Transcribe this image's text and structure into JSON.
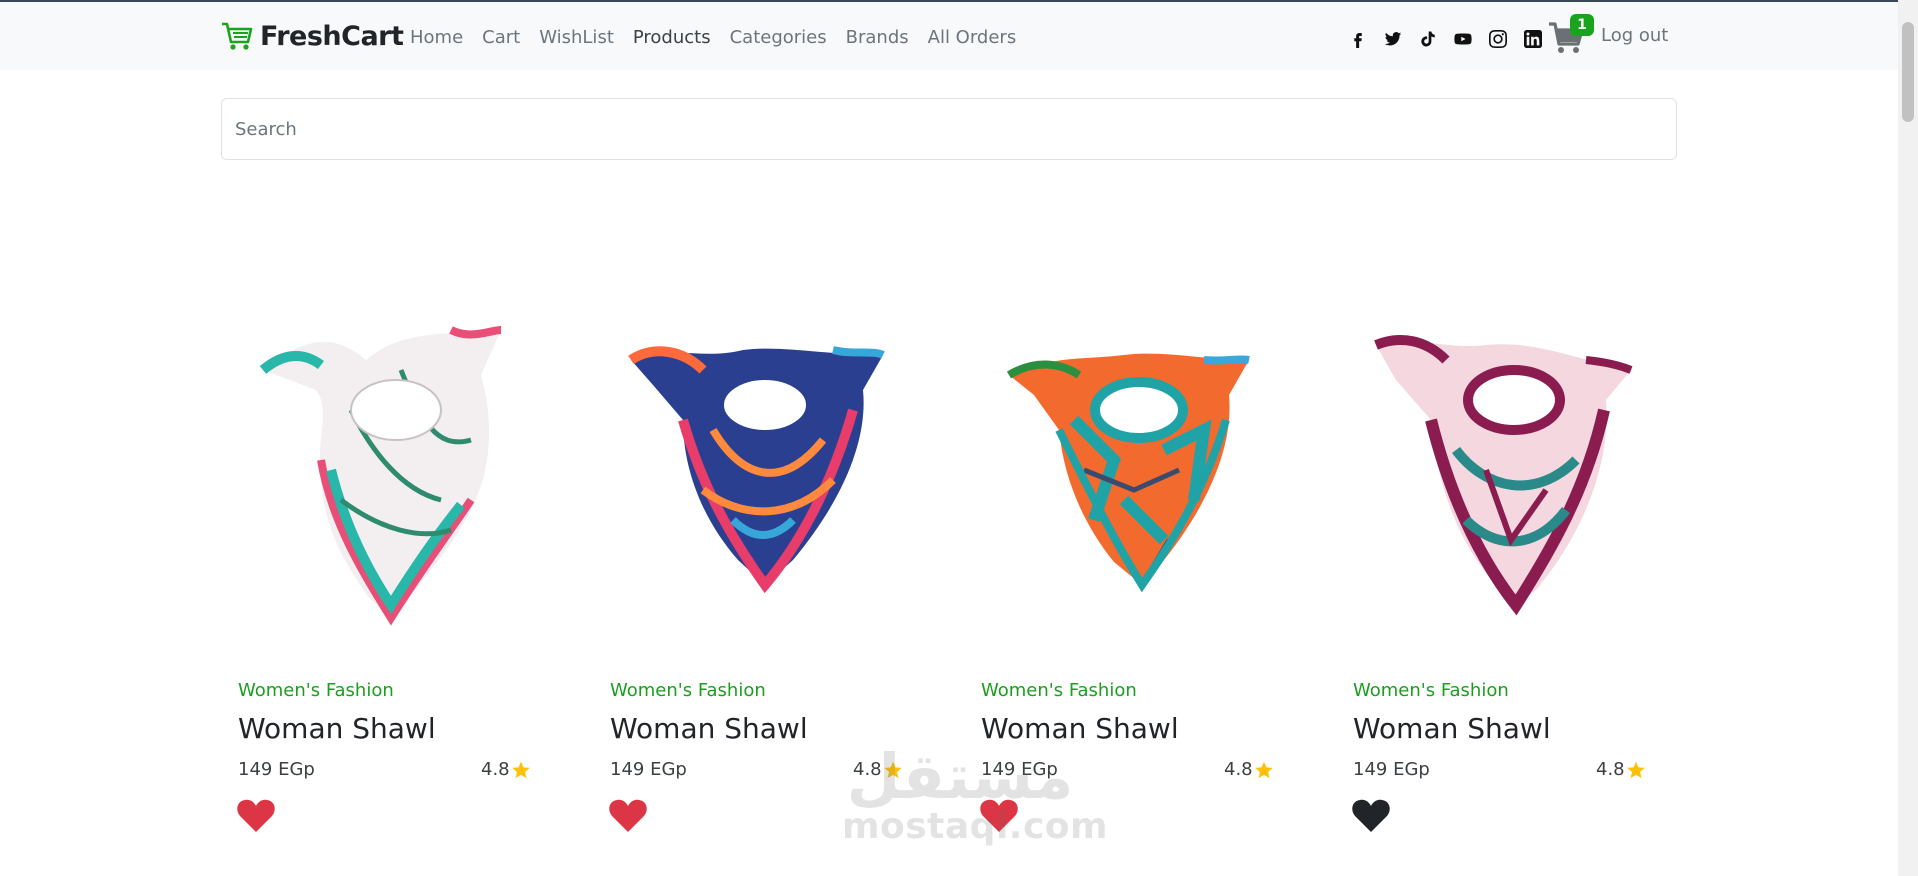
{
  "nav": {
    "brand": "FreshCart",
    "links": [
      "Home",
      "Cart",
      "WishList",
      "Products",
      "Categories",
      "Brands",
      "All Orders"
    ],
    "socials": [
      "facebook-icon",
      "twitter-icon",
      "tiktok-icon",
      "youtube-icon",
      "instagram-icon",
      "linkedin-icon"
    ],
    "cart_count": "1",
    "logout": "Log out"
  },
  "search": {
    "placeholder": "Search",
    "value": ""
  },
  "products": [
    {
      "category": "Women's Fashion",
      "title": "Woman Shawl",
      "price": "149 EGp",
      "rating": "4.8",
      "wishlisted": true
    },
    {
      "category": "Women's Fashion",
      "title": "Woman Shawl",
      "price": "149 EGp",
      "rating": "4.8",
      "wishlisted": true
    },
    {
      "category": "Women's Fashion",
      "title": "Woman Shawl",
      "price": "149 EGp",
      "rating": "4.8",
      "wishlisted": true
    },
    {
      "category": "Women's Fashion",
      "title": "Woman Shawl",
      "price": "149 EGp",
      "rating": "4.8",
      "wishlisted": false
    }
  ],
  "watermark": {
    "arabic": "مستقل",
    "latin": "mostaql.com"
  },
  "colors": {
    "accent_green": "#1aa31c",
    "heart_red": "#dc3545",
    "heart_dark": "#212529",
    "star": "#ffc107"
  }
}
